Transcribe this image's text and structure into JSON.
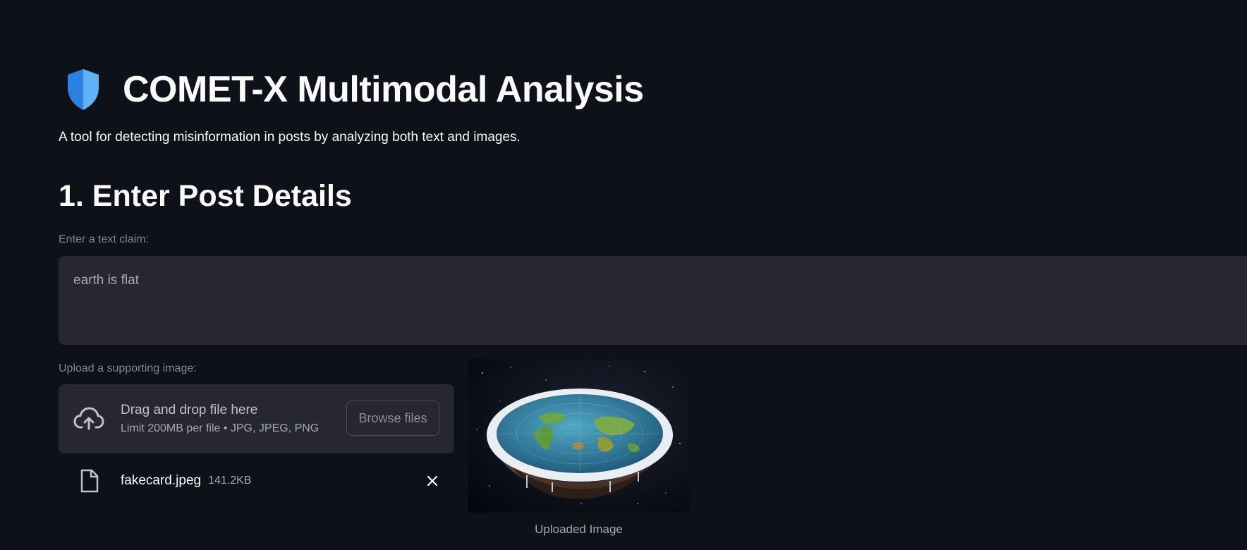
{
  "header": {
    "title": "COMET-X Multimodal Analysis",
    "subtitle": "A tool for detecting misinformation in posts by analyzing both text and images.",
    "icon": "shield-icon"
  },
  "section": {
    "heading": "1. Enter Post Details"
  },
  "text_claim": {
    "label": "Enter a text claim:",
    "value": "earth is flat"
  },
  "image_upload": {
    "label": "Upload a supporting image:",
    "dropzone_title": "Drag and drop file here",
    "dropzone_limit": "Limit 200MB per file • JPG, JPEG, PNG",
    "browse_label": "Browse files",
    "file": {
      "name": "fakecard.jpeg",
      "size": "141.2KB"
    }
  },
  "preview": {
    "caption": "Uploaded Image"
  },
  "colors": {
    "background": "#0e1117",
    "input_bg": "#262730",
    "text": "#fafafa",
    "muted": "#808495"
  }
}
